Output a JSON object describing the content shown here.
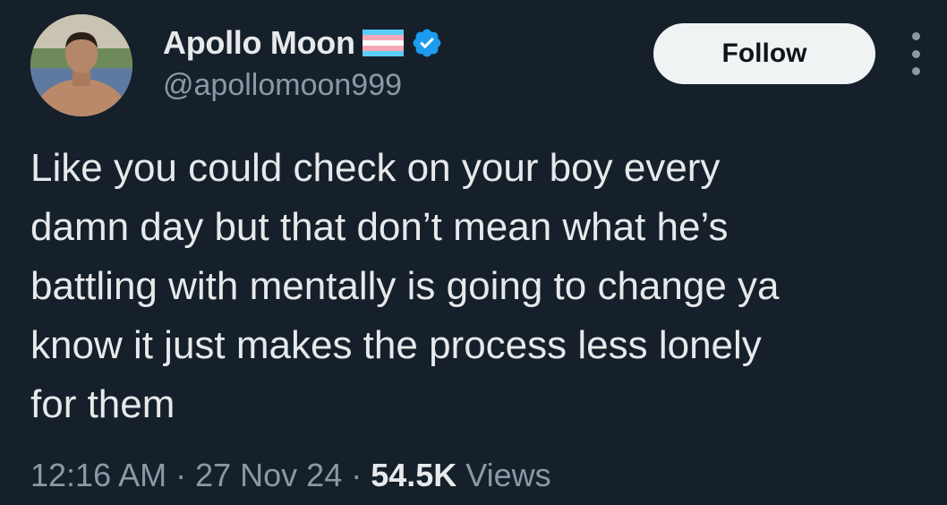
{
  "author": {
    "display_name": "Apollo Moon",
    "handle": "@apollomoon999",
    "flag_icon": "transgender-flag-icon",
    "verified_icon": "verified-badge-icon"
  },
  "actions": {
    "follow_label": "Follow",
    "more_icon": "more-vertical-icon"
  },
  "tweet": {
    "lines": [
      "Like you could check on your boy every",
      "damn day but that don’t mean what he’s",
      "battling with mentally is going to change ya",
      "know it just makes the process less lonely",
      "for them"
    ]
  },
  "meta": {
    "time": "12:16 AM",
    "sep1": "·",
    "date": "27 Nov 24",
    "sep2": "·",
    "views_count": "54.5K",
    "views_label": "Views"
  },
  "colors": {
    "background": "#15202b",
    "text_primary": "#e7e9ea",
    "text_secondary": "#8b98a5",
    "verified_blue": "#1d9bf0",
    "follow_bg": "#eff3f4"
  }
}
